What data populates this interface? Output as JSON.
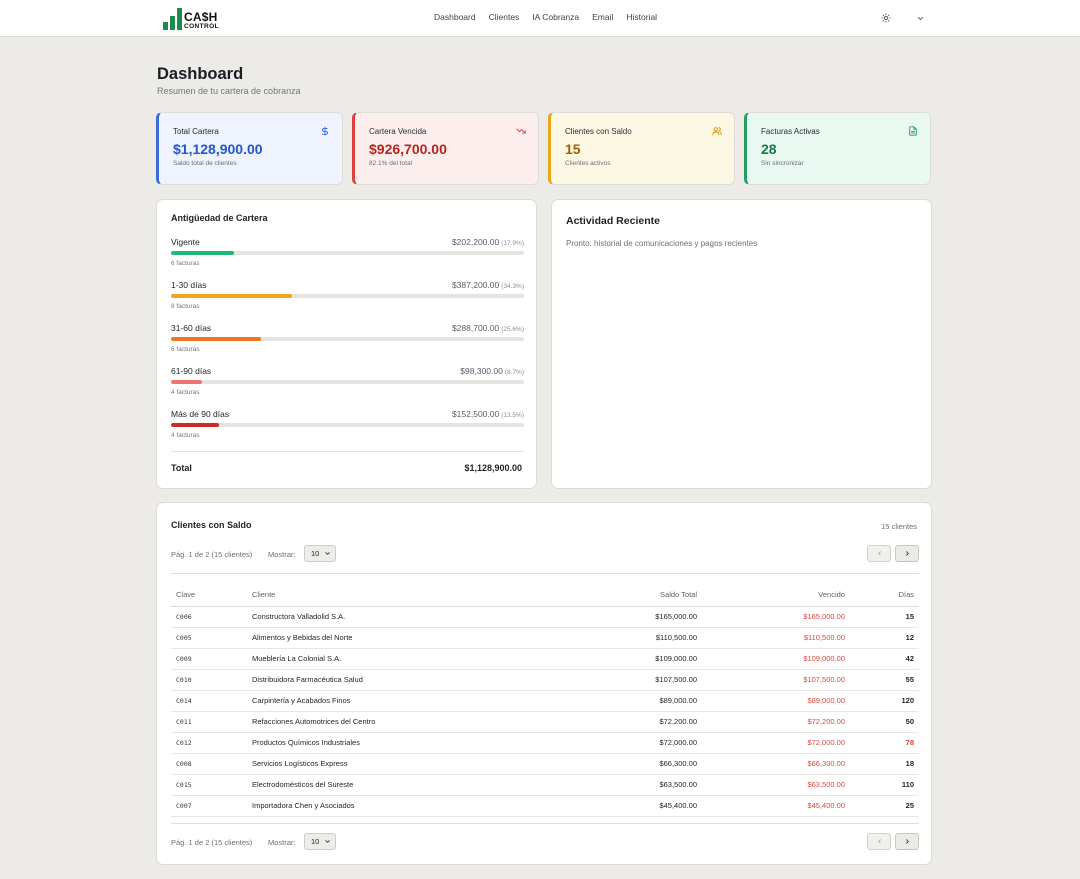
{
  "app": {
    "logo_line1": "CA$H",
    "logo_line2": "CONTROL",
    "brand_color": "#1e8a4c"
  },
  "nav": [
    "Dashboard",
    "Clientes",
    "IA Cobranza",
    "Email",
    "Historial"
  ],
  "header": {
    "title": "Dashboard",
    "subtitle": "Resumen de tu cartera de cobranza"
  },
  "stats": [
    {
      "title": "Total Cartera",
      "value": "$1,128,900.00",
      "sub": "Saldo total de clientes",
      "icon": "dollar-icon",
      "color": "#2456c5"
    },
    {
      "title": "Cartera Vencida",
      "value": "$926,700.00",
      "sub": "82.1% del total",
      "icon": "trending-down-icon",
      "color": "#b3261e"
    },
    {
      "title": "Clientes con Saldo",
      "value": "15",
      "sub": "Clientes activos",
      "icon": "users-icon",
      "color": "#a06105"
    },
    {
      "title": "Facturas Activas",
      "value": "28",
      "sub": "Sin sincronizar",
      "icon": "file-icon",
      "color": "#157a47"
    }
  ],
  "aging": {
    "title": "Antigüedad de Cartera",
    "rows": [
      {
        "label": "Vigente",
        "amount": "$202,200.00",
        "pct": "(17.9%)",
        "fraction": 0.179,
        "count": "6 facturas",
        "color": "#1fb97a"
      },
      {
        "label": "1-30 días",
        "amount": "$387,200.00",
        "pct": "(34.3%)",
        "fraction": 0.343,
        "count": "8 facturas",
        "color": "#f0a51c"
      },
      {
        "label": "31-60 días",
        "amount": "$288,700.00",
        "pct": "(25.6%)",
        "fraction": 0.256,
        "count": "6 facturas",
        "color": "#ef7420"
      },
      {
        "label": "61-90 días",
        "amount": "$98,300.00",
        "pct": "(8.7%)",
        "fraction": 0.087,
        "count": "4 facturas",
        "color": "#ef7474"
      },
      {
        "label": "Más de 90 días",
        "amount": "$152,500.00",
        "pct": "(13.5%)",
        "fraction": 0.135,
        "count": "4 facturas",
        "color": "#cf2a2a"
      }
    ],
    "total_label": "Total",
    "total_value": "$1,128,900.00"
  },
  "activity": {
    "title": "Actividad Reciente",
    "text": "Pronto: historial de comunicaciones y pagos recientes"
  },
  "clients": {
    "title": "Clientes con Saldo",
    "count": "15 clientes",
    "pager_info": "Pág. 1 de 2 (15 clientes)",
    "show_label": "Mostrar:",
    "page_size": "10",
    "columns": [
      "Clave",
      "Cliente",
      "Saldo Total",
      "Vencido",
      "Días"
    ],
    "rows": [
      {
        "key": "C006",
        "client": "Constructora Valladolid S.A.",
        "saldo": "$165,000.00",
        "vencido": "$165,000.00",
        "dias": "15",
        "level": "yellow"
      },
      {
        "key": "C005",
        "client": "Alimentos y Bebidas del Norte",
        "saldo": "$110,500.00",
        "vencido": "$110,500.00",
        "dias": "12",
        "level": "yellow"
      },
      {
        "key": "C009",
        "client": "Mueblería La Colonial S.A.",
        "saldo": "$109,000.00",
        "vencido": "$109,000.00",
        "dias": "42",
        "level": "orange"
      },
      {
        "key": "C010",
        "client": "Distribuidora Farmacéutica Salud",
        "saldo": "$107,500.00",
        "vencido": "$107,500.00",
        "dias": "55",
        "level": "orange"
      },
      {
        "key": "C014",
        "client": "Carpintería y Acabados Finos",
        "saldo": "$89,000.00",
        "vencido": "$89,000.00",
        "dias": "120",
        "level": "red"
      },
      {
        "key": "C011",
        "client": "Refacciones Automotrices del Centro",
        "saldo": "$72,200.00",
        "vencido": "$72,200.00",
        "dias": "50",
        "level": "orange"
      },
      {
        "key": "C012",
        "client": "Productos Químicos Industriales",
        "saldo": "$72,000.00",
        "vencido": "$72,000.00",
        "dias": "78",
        "level": "red-light"
      },
      {
        "key": "C008",
        "client": "Servicios Logísticos Express",
        "saldo": "$66,300.00",
        "vencido": "$66,300.00",
        "dias": "18",
        "level": "yellow"
      },
      {
        "key": "C015",
        "client": "Electrodomésticos del Sureste",
        "saldo": "$63,500.00",
        "vencido": "$63,500.00",
        "dias": "110",
        "level": "red"
      },
      {
        "key": "C007",
        "client": "Importadora Chen y Asociados",
        "saldo": "$45,400.00",
        "vencido": "$45,400.00",
        "dias": "25",
        "level": "yellow"
      }
    ]
  }
}
